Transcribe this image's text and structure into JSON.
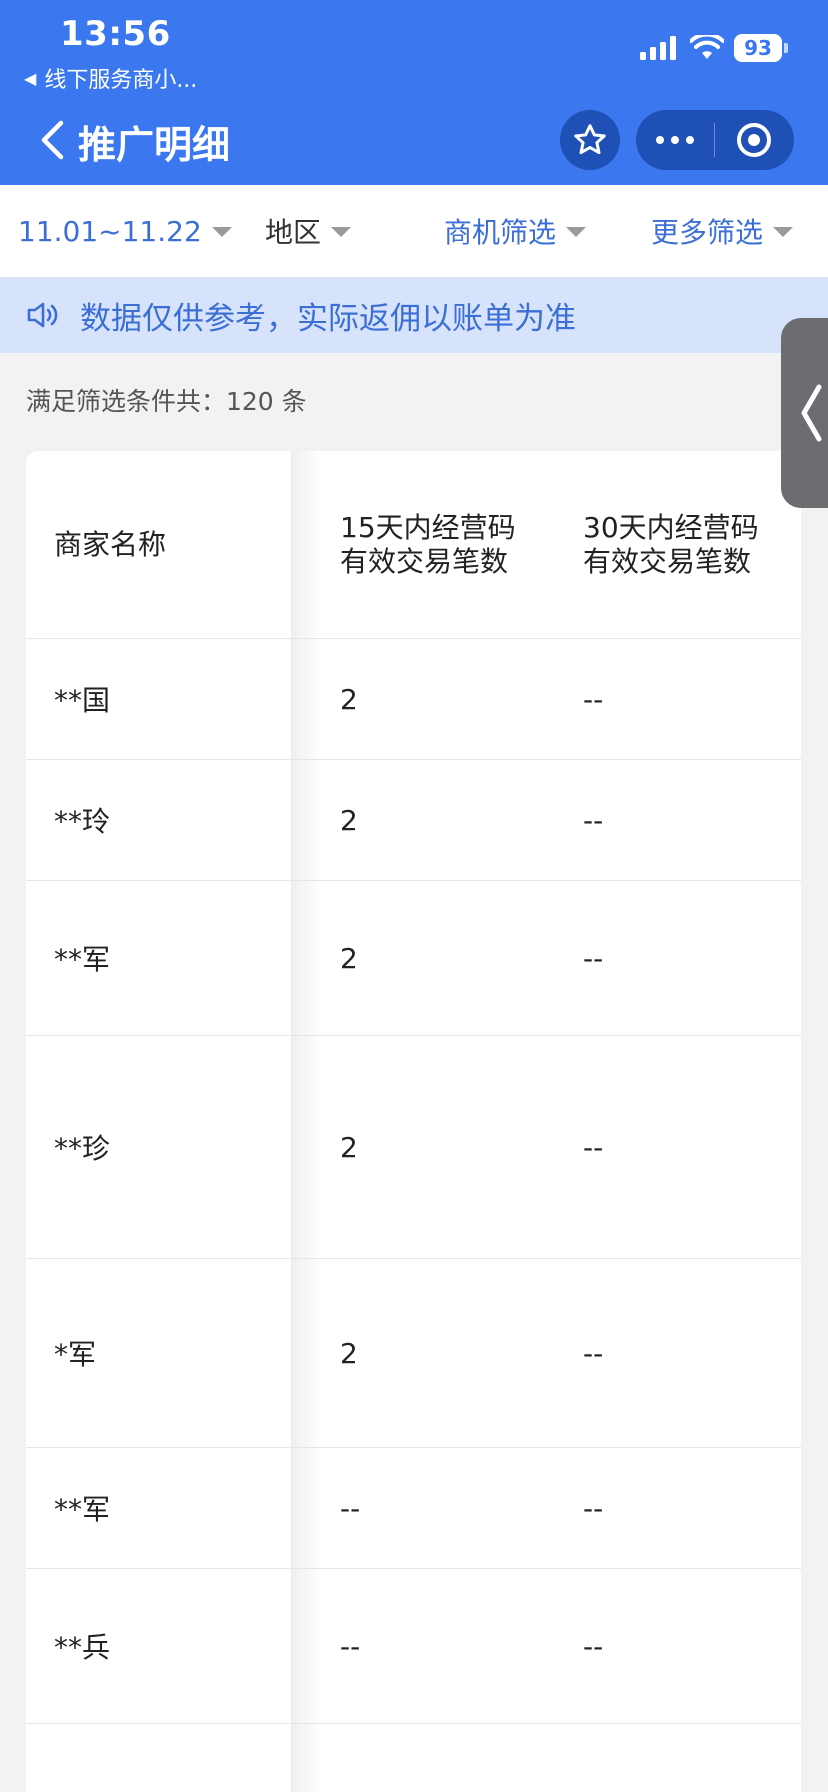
{
  "status_bar": {
    "time": "13:56",
    "back_app_label": "线下服务商小...",
    "battery": "93",
    "icons": [
      "signal-icon",
      "wifi-icon",
      "battery-icon"
    ]
  },
  "nav": {
    "title": "推广明细",
    "icons": [
      "back-chevron-icon",
      "star-icon",
      "more-dots-icon",
      "target-icon"
    ]
  },
  "filters": {
    "date_range": "11.01~11.22",
    "region": "地区",
    "opportunity": "商机筛选",
    "more": "更多筛选"
  },
  "notice": {
    "text": "数据仅供参考，实际返佣以账单为准"
  },
  "count_text": "满足筛选条件共：120 条",
  "table": {
    "headers": {
      "name": "商家名称",
      "col15_line1": "15天内经营码",
      "col15_line2": "有效交易笔数",
      "col30_line1": "30天内经营码",
      "col30_line2": "有效交易笔数"
    },
    "rows": [
      {
        "name": "**国",
        "d15": "2",
        "d30": "--"
      },
      {
        "name": "**玲",
        "d15": "2",
        "d30": "--"
      },
      {
        "name": "**军",
        "d15": "2",
        "d30": "--"
      },
      {
        "name": "**珍",
        "d15": "2",
        "d30": "--"
      },
      {
        "name": "*军",
        "d15": "2",
        "d30": "--"
      },
      {
        "name": "**军",
        "d15": "--",
        "d30": "--"
      },
      {
        "name": "**兵",
        "d15": "--",
        "d30": "--"
      },
      {
        "name": "",
        "d15": "",
        "d30": ""
      }
    ]
  },
  "colors": {
    "header_blue": "#3b78ef",
    "link_blue": "#3b6fd6",
    "notice_bg": "#d6e3fb"
  }
}
